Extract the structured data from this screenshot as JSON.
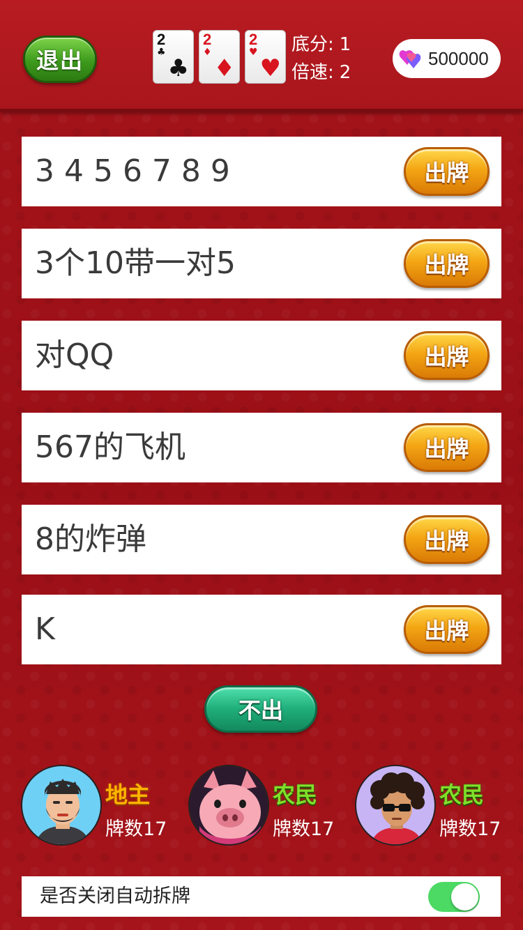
{
  "header": {
    "exit_label": "退出",
    "cards": [
      {
        "rank": "2",
        "suit": "♣",
        "color": "black"
      },
      {
        "rank": "2",
        "suit": "♦",
        "color": "red"
      },
      {
        "rank": "2",
        "suit": "♥",
        "color": "red"
      }
    ],
    "base_score_label": "底分:",
    "base_score_value": "1",
    "multiplier_label": "倍速:",
    "multiplier_value": "2",
    "coins": "500000",
    "coin_icon": "gem-hearts-icon"
  },
  "options": [
    {
      "label": "3 4 5 6 7 8 9",
      "button": "出牌"
    },
    {
      "label": "3个10带一对5",
      "button": "出牌"
    },
    {
      "label": "对QQ",
      "button": "出牌"
    },
    {
      "label": "567的飞机",
      "button": "出牌"
    },
    {
      "label": "8的炸弹",
      "button": "出牌"
    },
    {
      "label": "K",
      "button": "出牌"
    }
  ],
  "pass_label": "不出",
  "players": [
    {
      "role": "地主",
      "count": "牌数17",
      "avatar": "bearded-man-avatar"
    },
    {
      "role": "农民",
      "count": "牌数17",
      "avatar": "pig-avatar"
    },
    {
      "role": "农民",
      "count": "牌数17",
      "avatar": "curly-hair-sunglasses-avatar"
    }
  ],
  "toggle": {
    "label": "是否关闭自动拆牌",
    "state": "on"
  },
  "colors": {
    "background": "#9e1016",
    "play_button": "#f4a614",
    "pass_button": "#1fae7a",
    "exit_button": "#3d9a1c",
    "landlord": "#ffb400",
    "farmer": "#7fe02a",
    "switch_on": "#4cd964"
  }
}
